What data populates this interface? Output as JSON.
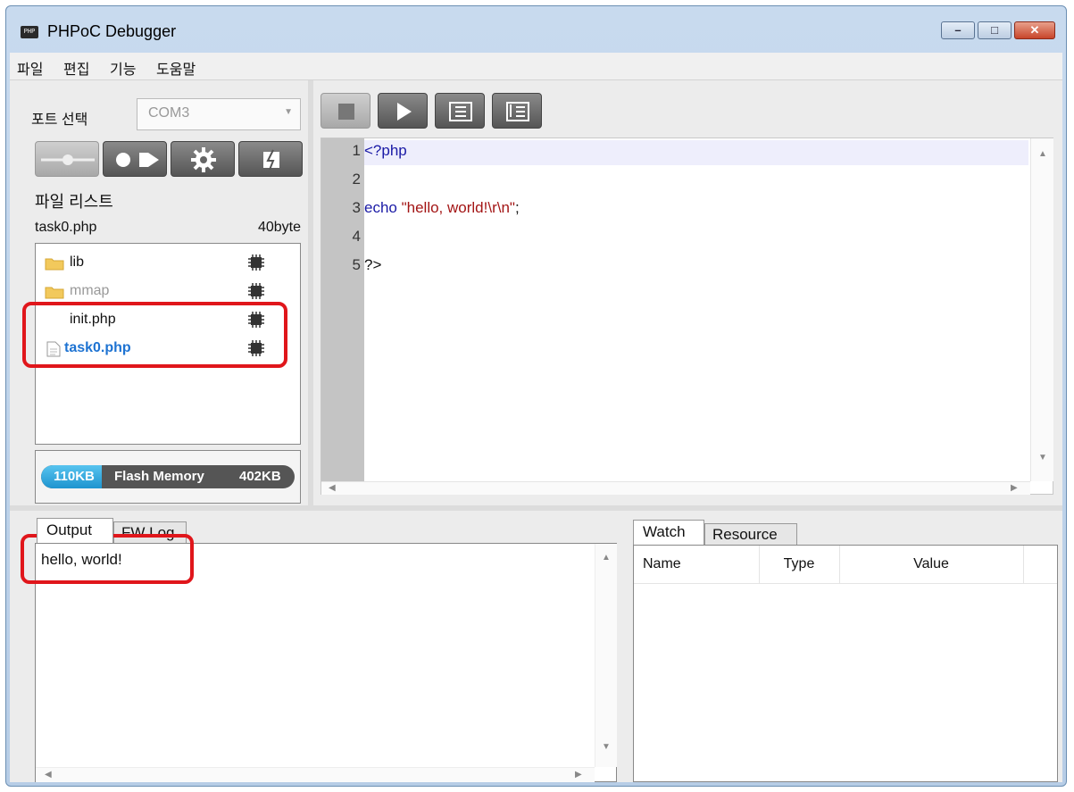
{
  "window": {
    "title": "PHPoC Debugger",
    "app_icon_text": "PHP"
  },
  "menu": [
    "파일",
    "편집",
    "기능",
    "도움말"
  ],
  "port": {
    "label": "포트 선택",
    "value": "COM3"
  },
  "file_list": {
    "label": "파일 리스트",
    "selected_name": "task0.php",
    "selected_size": "40byte",
    "items": [
      {
        "name": "lib",
        "type": "folder"
      },
      {
        "name": "mmap",
        "type": "folder"
      },
      {
        "name": "init.php",
        "type": "file"
      },
      {
        "name": "task0.php",
        "type": "file"
      }
    ]
  },
  "flash": {
    "used": "110KB",
    "label": "Flash Memory",
    "total": "402KB"
  },
  "editor": {
    "lines": [
      {
        "n": "1",
        "parts": [
          [
            "<?php",
            "#1a1aa6"
          ]
        ]
      },
      {
        "n": "2",
        "parts": []
      },
      {
        "n": "3",
        "parts": [
          [
            "echo ",
            "#1a1aa6"
          ],
          [
            "\"hello, world!\\r\\n\"",
            "#a31515"
          ],
          [
            ";",
            "#111111"
          ]
        ]
      },
      {
        "n": "4",
        "parts": []
      },
      {
        "n": "5",
        "parts": [
          [
            "?>",
            "#111111"
          ]
        ]
      }
    ]
  },
  "output_tabs": [
    "Output",
    "FW Log"
  ],
  "output_text": "hello, world!",
  "watch_tabs": [
    "Watch",
    "Resource"
  ],
  "watch_columns": [
    "Name",
    "Type",
    "Value"
  ],
  "colors": {
    "highlight": "#e0161b",
    "selected_file": "#1e73d2",
    "flash_bar": "#2aa7e0"
  }
}
